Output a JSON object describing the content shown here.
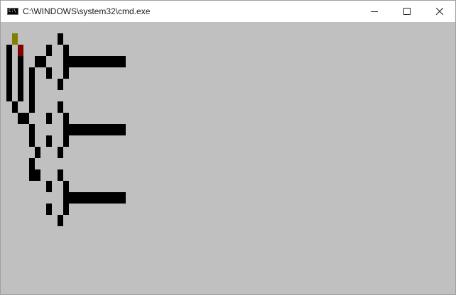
{
  "window": {
    "title": "C:\\WINDOWS\\system32\\cmd.exe",
    "icon": "cmd-icon",
    "icon_text": "C:\\",
    "controls": [
      "minimize-icon",
      "maximize-icon",
      "close-icon"
    ]
  },
  "console": {
    "background_color": "#c0c0c0",
    "glyph_color": "#000000",
    "accent_colors": {
      "yellow": "#808000",
      "red": "#800000"
    }
  }
}
